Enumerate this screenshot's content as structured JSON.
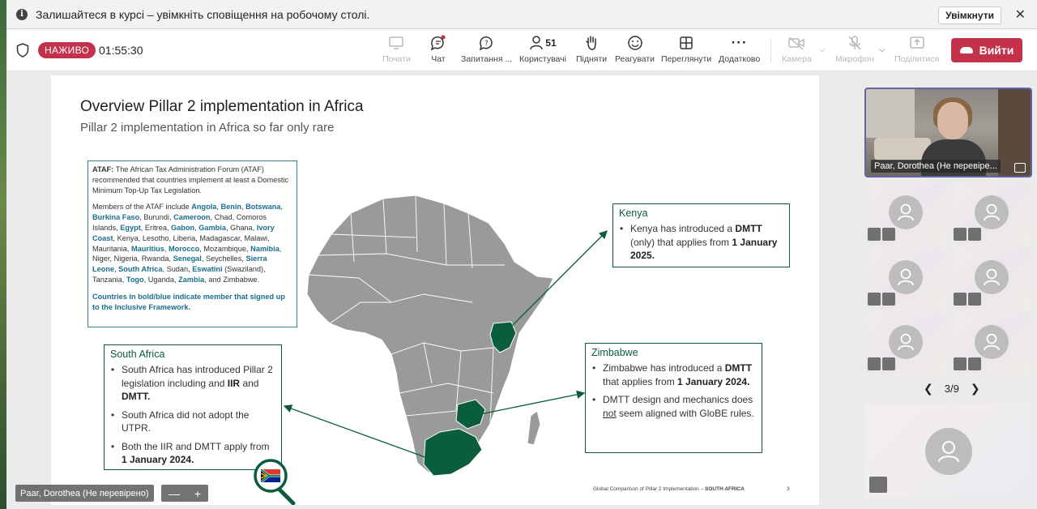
{
  "notification": {
    "message": "Залишайтеся в курсі – увімкніть сповіщення на робочому столі.",
    "enable_label": "Увімкнути",
    "close_glyph": "✕"
  },
  "toolbar": {
    "live_label": "НАЖИВО",
    "timer": "01:55:30",
    "start": "Почати",
    "chat": "Чат",
    "qa": "Запитання ...",
    "people": "Користувачі",
    "people_count": "51",
    "raise": "Підняти",
    "react": "Реагувати",
    "view": "Переглянути",
    "more": "Додатково",
    "camera": "Камера",
    "mic": "Мікрофон",
    "share": "Поділитися",
    "leave": "Вийти"
  },
  "slide": {
    "title": "Overview Pillar 2 implementation in Africa",
    "subtitle": "Pillar 2 implementation in Africa so far only rare",
    "ataf": {
      "bold_prefix": "ATAF:",
      "intro": " The African Tax Administration Forum (ATAF) recommended that countries implement at least a Domestic Minimum Top-Up Tax Legislation.",
      "members_intro": "Members of the ATAF include ",
      "members": [
        {
          "name": "Angola",
          "m": true
        },
        {
          "name": "Benin",
          "m": true
        },
        {
          "name": "Botswana",
          "m": true
        },
        {
          "name": "Burkina Faso",
          "m": true
        },
        {
          "name": "Burundi",
          "m": false
        },
        {
          "name": "Cameroon",
          "m": true
        },
        {
          "name": "Chad",
          "m": false
        },
        {
          "name": "Comoros Islands",
          "m": false
        },
        {
          "name": "Egypt",
          "m": true
        },
        {
          "name": "Eritrea",
          "m": false
        },
        {
          "name": "Gabon",
          "m": true
        },
        {
          "name": "Gambia",
          "m": true
        },
        {
          "name": "Ghana",
          "m": false
        },
        {
          "name": "Ivory Coast",
          "m": true
        },
        {
          "name": "Kenya",
          "m": false
        },
        {
          "name": "Lesotho",
          "m": false
        },
        {
          "name": "Liberia",
          "m": false
        },
        {
          "name": "Madagascar",
          "m": false
        },
        {
          "name": "Malawi",
          "m": false
        },
        {
          "name": "Mauritania",
          "m": false
        },
        {
          "name": "Mauritius",
          "m": true
        },
        {
          "name": "Morocco",
          "m": true
        },
        {
          "name": "Mozambique",
          "m": false
        },
        {
          "name": "Namibia",
          "m": true
        },
        {
          "name": "Niger",
          "m": false
        },
        {
          "name": "Nigeria",
          "m": false
        },
        {
          "name": "Rwanda",
          "m": false
        },
        {
          "name": "Senegal",
          "m": true
        },
        {
          "name": "Seychelles",
          "m": false
        },
        {
          "name": "Sierra Leone",
          "m": true
        },
        {
          "name": "South Africa",
          "m": true
        },
        {
          "name": "Sudan",
          "m": false
        },
        {
          "name": "Eswatini",
          "m": true,
          "suffix": " (Swaziland)"
        },
        {
          "name": "Tanzania",
          "m": false
        },
        {
          "name": "Togo",
          "m": true
        },
        {
          "name": "Uganda",
          "m": false
        },
        {
          "name": "Zambia",
          "m": true
        },
        {
          "name": "Zimbabwe",
          "m": false,
          "prefix": "and "
        }
      ],
      "note": "Countries in bold/blue indicate member that signed up to the Inclusive Framework."
    },
    "kenya": {
      "heading": "Kenya",
      "b1_a": "Kenya has introduced a ",
      "b1_b": "DMTT",
      "b1_c": " (only) that applies from ",
      "b1_d": "1 January 2025."
    },
    "south_africa": {
      "heading": "South Africa",
      "b1_a": "South Africa has introduced Pillar 2 legislation including and ",
      "b1_b": "IIR",
      "b1_c": " and ",
      "b1_d": "DMTT.",
      "b2": "South Africa did not adopt the UTPR.",
      "b3_a": "Both the IIR and DMTT apply from ",
      "b3_b": "1 January 2024."
    },
    "zimbabwe": {
      "heading": "Zimbabwe",
      "b1_a": " Zimbabwe has introduced a ",
      "b1_b": "DMTT",
      "b1_c": " that applies from ",
      "b1_d": "1 January 2024.",
      "b2_a": "DMTT design and mechanics does ",
      "b2_b": "not",
      "b2_c": " seem aligned with GloBE rules."
    },
    "footer_a": "Global Comparison of Pillar 2 Implementation – ",
    "footer_b": "SOUTH AFRICA",
    "page_number": "3"
  },
  "stage": {
    "presenter_name": "Paar, Dorothea (Не перевірено)",
    "zoom_out": "—",
    "zoom_in": "+"
  },
  "gallery": {
    "presenter_name": "Paar, Dorothea (Не перевіре...",
    "page": "3/9",
    "prev": "❮",
    "next": "❯"
  },
  "colors": {
    "live": "#c4314b",
    "green": "#0a5c3a",
    "teal": "#3a7f8c",
    "map_grey": "#9a9a9a",
    "highlight": "#0b5e3c"
  }
}
